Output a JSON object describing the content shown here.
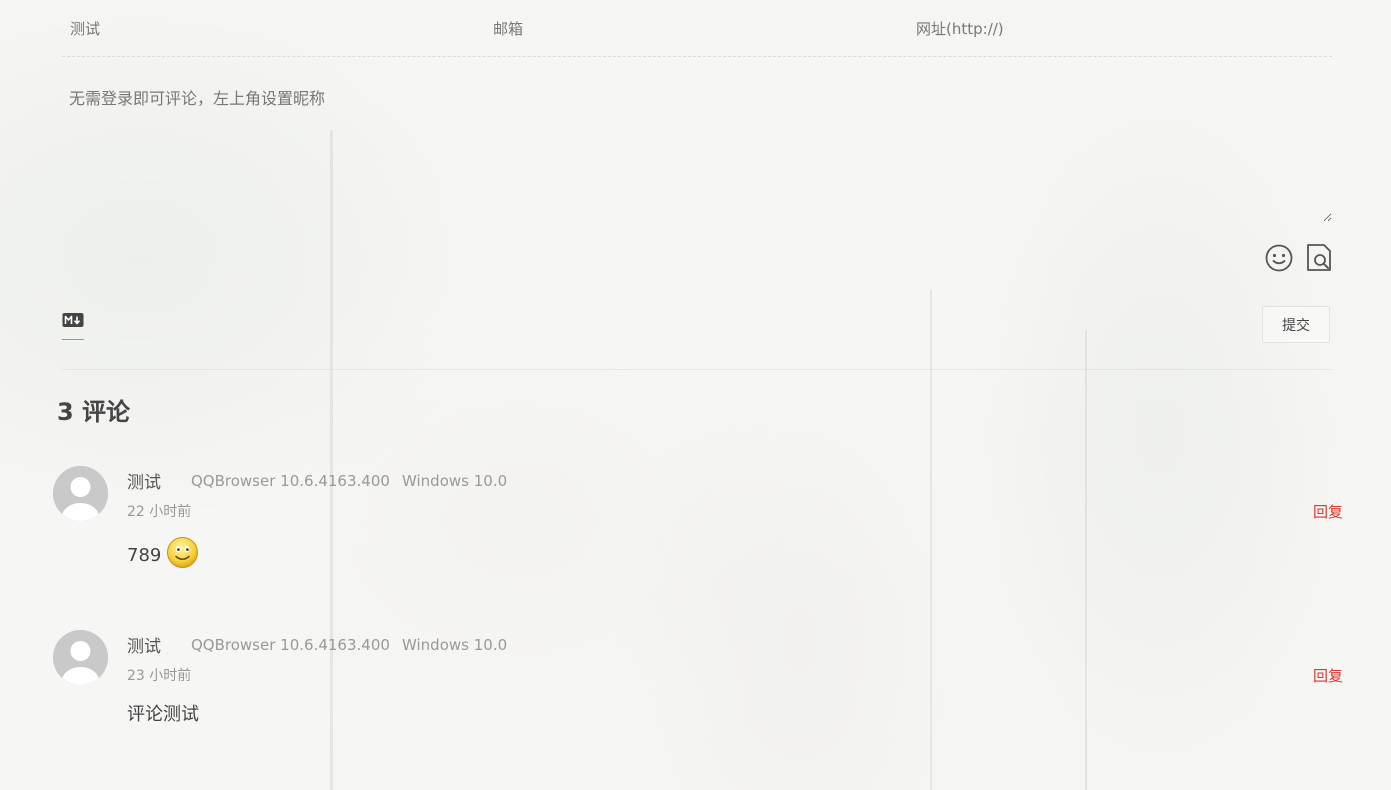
{
  "form": {
    "nick_placeholder": "测试",
    "mail_placeholder": "邮箱",
    "link_placeholder": "网址(http://)",
    "editor_placeholder": "无需登录即可评论，左上角设置昵称",
    "submit_label": "提交"
  },
  "comments_count": {
    "label": "3 评论"
  },
  "comments": [
    {
      "author": "测试",
      "browser": "QQBrowser 10.6.4163.400",
      "os": "Windows 10.0",
      "time": "22 小时前",
      "reply_label": "回复",
      "content": "789",
      "emoji": "smiley-emoji"
    },
    {
      "author": "测试",
      "browser": "QQBrowser 10.6.4163.400",
      "os": "Windows 10.0",
      "time": "23 小时前",
      "reply_label": "回复",
      "content": "评论测试"
    }
  ],
  "colors": {
    "reply": "#d9382e",
    "muted_text": "#999999",
    "body_text": "#555555"
  },
  "icons": [
    "emoji-icon",
    "preview-icon",
    "markdown-icon",
    "avatar-icon"
  ]
}
